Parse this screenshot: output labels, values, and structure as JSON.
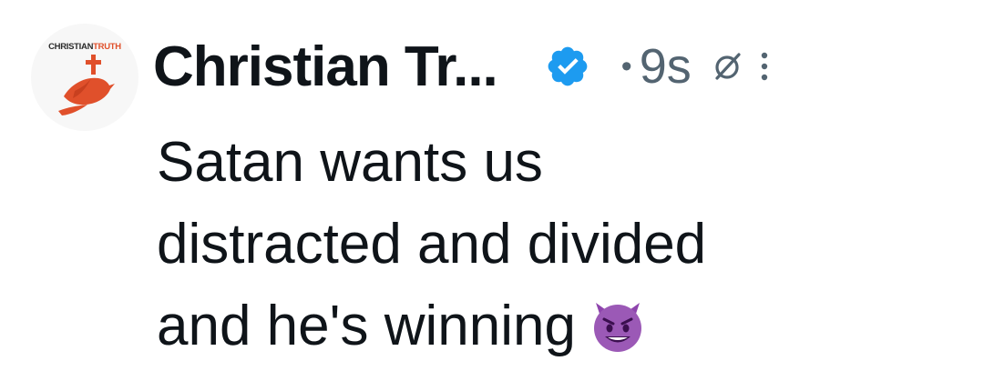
{
  "avatar": {
    "brand_part1": "CHRISTIAN",
    "brand_part2": "TRUTH",
    "icon": "dove-cross-icon"
  },
  "header": {
    "display_name": "Christian Tr...",
    "verified_icon": "verified-badge-icon",
    "separator": "•",
    "timestamp": "9s",
    "grok_icon": "grok-icon",
    "more_icon": "more-vertical-icon"
  },
  "tweet": {
    "lines": [
      "Satan wants us",
      "distracted and divided",
      "and he's winning"
    ],
    "emoji": "smiling-face-with-horns-icon"
  },
  "colors": {
    "text": "#0f1419",
    "secondary": "#536471",
    "verified": "#1d9bf0",
    "brand": "#e0502b",
    "emoji": "#8e44ad"
  }
}
